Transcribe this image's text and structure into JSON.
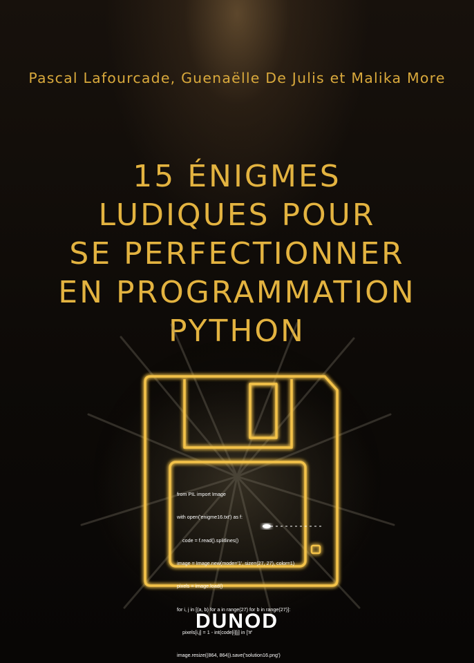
{
  "cover": {
    "authors": "Pascal Lafourcade, Guenaëlle De Julis et Malika More",
    "title_lines": [
      "15 ÉNIGMES",
      "LUDIQUES POUR",
      "SE PERFECTIONNER",
      "EN PROGRAMMATION",
      "PYTHON"
    ],
    "code_lines": [
      "from PIL import Image",
      "with open('enigme16.txt') as f:",
      "    code = f.read().splitlines()",
      "image = Image.new(mode='1', size=(27, 27), color=1)",
      "pixels = image.load()",
      "for i, j in [(a, b) for a in range(27) for b in range(27)]:",
      "    pixels[i,j] = 1 - int(code[i][j] in ['#'",
      "image.resize((864, 864)).save('solution16.png')"
    ],
    "publisher": "DUNOD",
    "colors": {
      "title": "#e3b340",
      "authors": "#d9a93c",
      "glow": "#f3c24a",
      "background": "#0c0907"
    },
    "icons": [
      "floppy-disk-icon"
    ]
  }
}
